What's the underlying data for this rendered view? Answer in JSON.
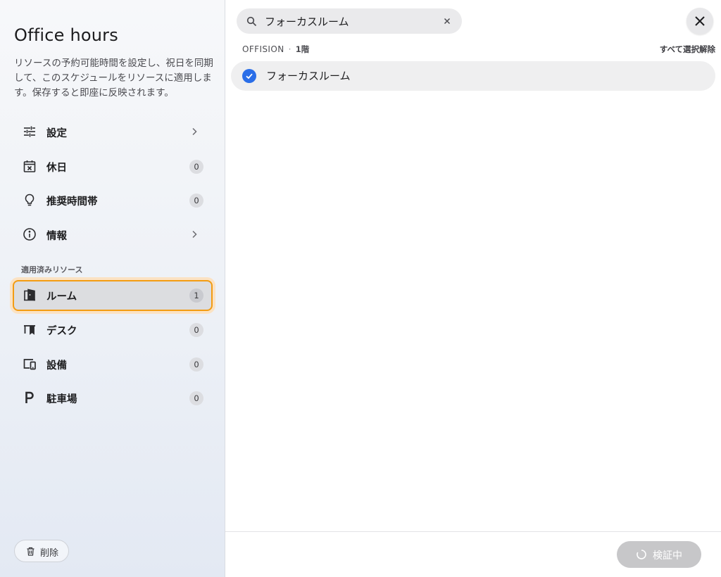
{
  "sidebar": {
    "title": "Office hours",
    "description": "リソースの予約可能時間を設定し、祝日を同期して、このスケジュールをリソースに適用します。保存すると即座に反映されます。",
    "items": [
      {
        "label": "設定",
        "icon": "sliders-icon",
        "trailing": "chevron"
      },
      {
        "label": "休日",
        "icon": "calendar-x-icon",
        "count": "0"
      },
      {
        "label": "推奨時間帯",
        "icon": "lightbulb-icon",
        "count": "0"
      },
      {
        "label": "情報",
        "icon": "info-icon",
        "trailing": "chevron"
      }
    ],
    "section_label": "適用済みリソース",
    "resources": [
      {
        "label": "ルーム",
        "icon": "room-door-icon",
        "count": "1",
        "selected": true
      },
      {
        "label": "デスク",
        "icon": "desk-icon",
        "count": "0"
      },
      {
        "label": "設備",
        "icon": "devices-icon",
        "count": "0"
      },
      {
        "label": "駐車場",
        "icon": "parking-icon",
        "count": "0"
      }
    ],
    "delete_label": "削除"
  },
  "main": {
    "search": {
      "value": "フォーカスルーム",
      "placeholder": ""
    },
    "group": {
      "building": "OFFISION",
      "separator": "·",
      "floor": "1階"
    },
    "deselect_all_label": "すべて選択解除",
    "results": [
      {
        "label": "フォーカスルーム",
        "checked": true
      }
    ],
    "footer": {
      "verify_label": "検証中"
    }
  },
  "colors": {
    "accent": "#2a6ee8",
    "selection_border": "#f39c12",
    "selection_glow": "#fbe2c3",
    "disabled_button": "#c7c7c9"
  }
}
